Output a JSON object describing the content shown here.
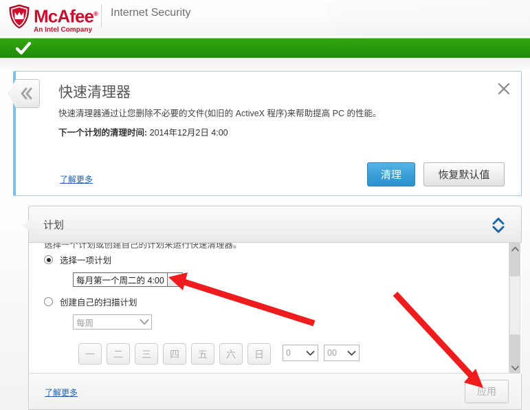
{
  "brand": {
    "name": "McAfee",
    "trademark": "®",
    "tagline": "An Intel Company",
    "product": "Internet Security",
    "red": "#c8102e"
  },
  "status_strip": {
    "icon": "check-icon",
    "color": "#2a9a0c"
  },
  "card": {
    "back_icon": "chevron-double-left-icon",
    "close_icon": "close-icon",
    "title": "快速清理器",
    "description": "快速清理器通过让您删除不必要的文件(如旧的 ActiveX 程序)来帮助提高 PC 的性能。",
    "next_label": "下一个计划的清理时间:",
    "next_value": "2014年12月2日  4:00",
    "learn_more": "了解更多",
    "clean_button": "清理",
    "restore_button": "恢复默认值",
    "accent": "#3ba0d8"
  },
  "panel": {
    "title": "计划",
    "collapse_icon": "chevron-up-down-icon",
    "clipped_text": "选择一个计划或创建自己的计划来运行快速清理器。",
    "option_preset": {
      "label": "选择一项计划",
      "selected": true,
      "dropdown_value": "每月第一个周二的 4:00"
    },
    "option_custom": {
      "label": "创建自己的扫描计划",
      "selected": false,
      "dropdown_value": "每周",
      "disabled": true
    },
    "day_buttons": [
      {
        "label": "一",
        "disabled": true
      },
      {
        "label": "二",
        "disabled": true
      },
      {
        "label": "三",
        "disabled": true
      },
      {
        "label": "四",
        "disabled": true
      },
      {
        "label": "五",
        "disabled": true
      },
      {
        "label": "六",
        "disabled": true
      },
      {
        "label": "日",
        "disabled": true
      }
    ],
    "time_hour": "0",
    "time_minute": "00",
    "scrollbar": {
      "up_icon": "chevron-up-icon",
      "down_icon": "chevron-down-icon"
    },
    "learn_more": "了解更多",
    "apply_button": "应用",
    "apply_disabled": true
  },
  "annotations": {
    "arrow_color": "#ee1c1c",
    "arrow_1_target": "schedule-preset-dropdown",
    "arrow_2_target": "apply-button"
  }
}
